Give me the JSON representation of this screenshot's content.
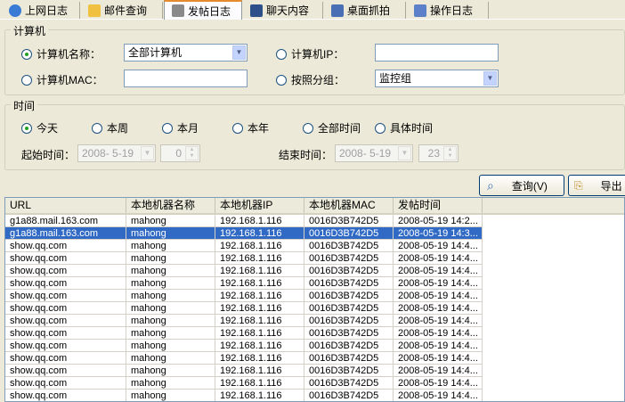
{
  "tabs": [
    {
      "label": "上网日志",
      "icon": "globe-icon"
    },
    {
      "label": "邮件查询",
      "icon": "mail-icon"
    },
    {
      "label": "发帖日志",
      "icon": "printer-icon"
    },
    {
      "label": "聊天内容",
      "icon": "chat-icon"
    },
    {
      "label": "桌面抓拍",
      "icon": "desktop-icon"
    },
    {
      "label": "操作日志",
      "icon": "operation-icon"
    }
  ],
  "computer_group": {
    "legend": "计算机",
    "name_label": "计算机名称：",
    "name_value": "全部计算机",
    "ip_label": "计算机IP：",
    "ip_value": "",
    "mac_label": "计算机MAC：",
    "mac_value": "",
    "group_label": "按照分组：",
    "group_value": "监控组"
  },
  "time_group": {
    "legend": "时间",
    "options": [
      "今天",
      "本周",
      "本月",
      "本年",
      "全部时间",
      "具体时间"
    ],
    "selected": "今天",
    "start_label": "起始时间：",
    "start_date": "2008- 5-19",
    "start_hour": "0",
    "end_label": "结束时间：",
    "end_date": "2008- 5-19",
    "end_hour": "23"
  },
  "buttons": {
    "query": "查询(V)",
    "export": "导出"
  },
  "table": {
    "columns": [
      "URL",
      "本地机器名称",
      "本地机器IP",
      "本地机器MAC",
      "发帖时间"
    ],
    "rows": [
      [
        "g1a88.mail.163.com",
        "mahong",
        "192.168.1.116",
        "0016D3B742D5",
        "2008-05-19 14:2..."
      ],
      [
        "g1a88.mail.163.com",
        "mahong",
        "192.168.1.116",
        "0016D3B742D5",
        "2008-05-19 14:3..."
      ],
      [
        "show.qq.com",
        "mahong",
        "192.168.1.116",
        "0016D3B742D5",
        "2008-05-19 14:4..."
      ],
      [
        "show.qq.com",
        "mahong",
        "192.168.1.116",
        "0016D3B742D5",
        "2008-05-19 14:4..."
      ],
      [
        "show.qq.com",
        "mahong",
        "192.168.1.116",
        "0016D3B742D5",
        "2008-05-19 14:4..."
      ],
      [
        "show.qq.com",
        "mahong",
        "192.168.1.116",
        "0016D3B742D5",
        "2008-05-19 14:4..."
      ],
      [
        "show.qq.com",
        "mahong",
        "192.168.1.116",
        "0016D3B742D5",
        "2008-05-19 14:4..."
      ],
      [
        "show.qq.com",
        "mahong",
        "192.168.1.116",
        "0016D3B742D5",
        "2008-05-19 14:4..."
      ],
      [
        "show.qq.com",
        "mahong",
        "192.168.1.116",
        "0016D3B742D5",
        "2008-05-19 14:4..."
      ],
      [
        "show.qq.com",
        "mahong",
        "192.168.1.116",
        "0016D3B742D5",
        "2008-05-19 14:4..."
      ],
      [
        "show.qq.com",
        "mahong",
        "192.168.1.116",
        "0016D3B742D5",
        "2008-05-19 14:4..."
      ],
      [
        "show.qq.com",
        "mahong",
        "192.168.1.116",
        "0016D3B742D5",
        "2008-05-19 14:4..."
      ],
      [
        "show.qq.com",
        "mahong",
        "192.168.1.116",
        "0016D3B742D5",
        "2008-05-19 14:4..."
      ],
      [
        "show.qq.com",
        "mahong",
        "192.168.1.116",
        "0016D3B742D5",
        "2008-05-19 14:4..."
      ],
      [
        "show.qq.com",
        "mahong",
        "192.168.1.116",
        "0016D3B742D5",
        "2008-05-19 14:4..."
      ]
    ],
    "selected_row": 1
  },
  "colors": {
    "selection": "#316ac5",
    "active_tab_accent": "#e68b2c",
    "window_bg": "#ece9d8"
  }
}
